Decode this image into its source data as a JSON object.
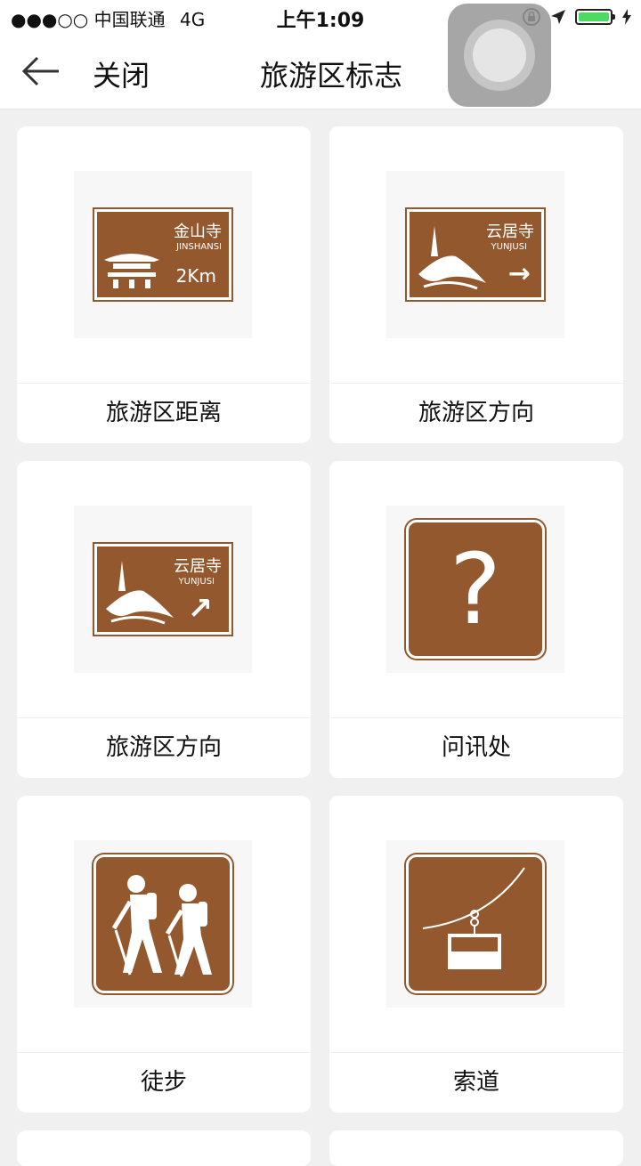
{
  "status_bar": {
    "signal": "●●●○○",
    "carrier": "中国联通",
    "network": "4G",
    "time": "上午1:09"
  },
  "nav": {
    "close_label": "关闭",
    "title": "旅游区标志"
  },
  "cards": [
    {
      "label": "旅游区距离",
      "sign_cn": "金山寺",
      "sign_en": "JINSHANSI",
      "sign_dist": "2Km"
    },
    {
      "label": "旅游区方向",
      "sign_cn": "云居寺",
      "sign_en": "YUNJUSI",
      "arrow": "→"
    },
    {
      "label": "旅游区方向",
      "sign_cn": "云居寺",
      "sign_en": "YUNJUSI",
      "arrow": "↗"
    },
    {
      "label": "问讯处",
      "symbol": "?"
    },
    {
      "label": "徒步"
    },
    {
      "label": "索道"
    }
  ],
  "colors": {
    "sign_brown": "#93582d",
    "battery_green": "#4cd964"
  }
}
